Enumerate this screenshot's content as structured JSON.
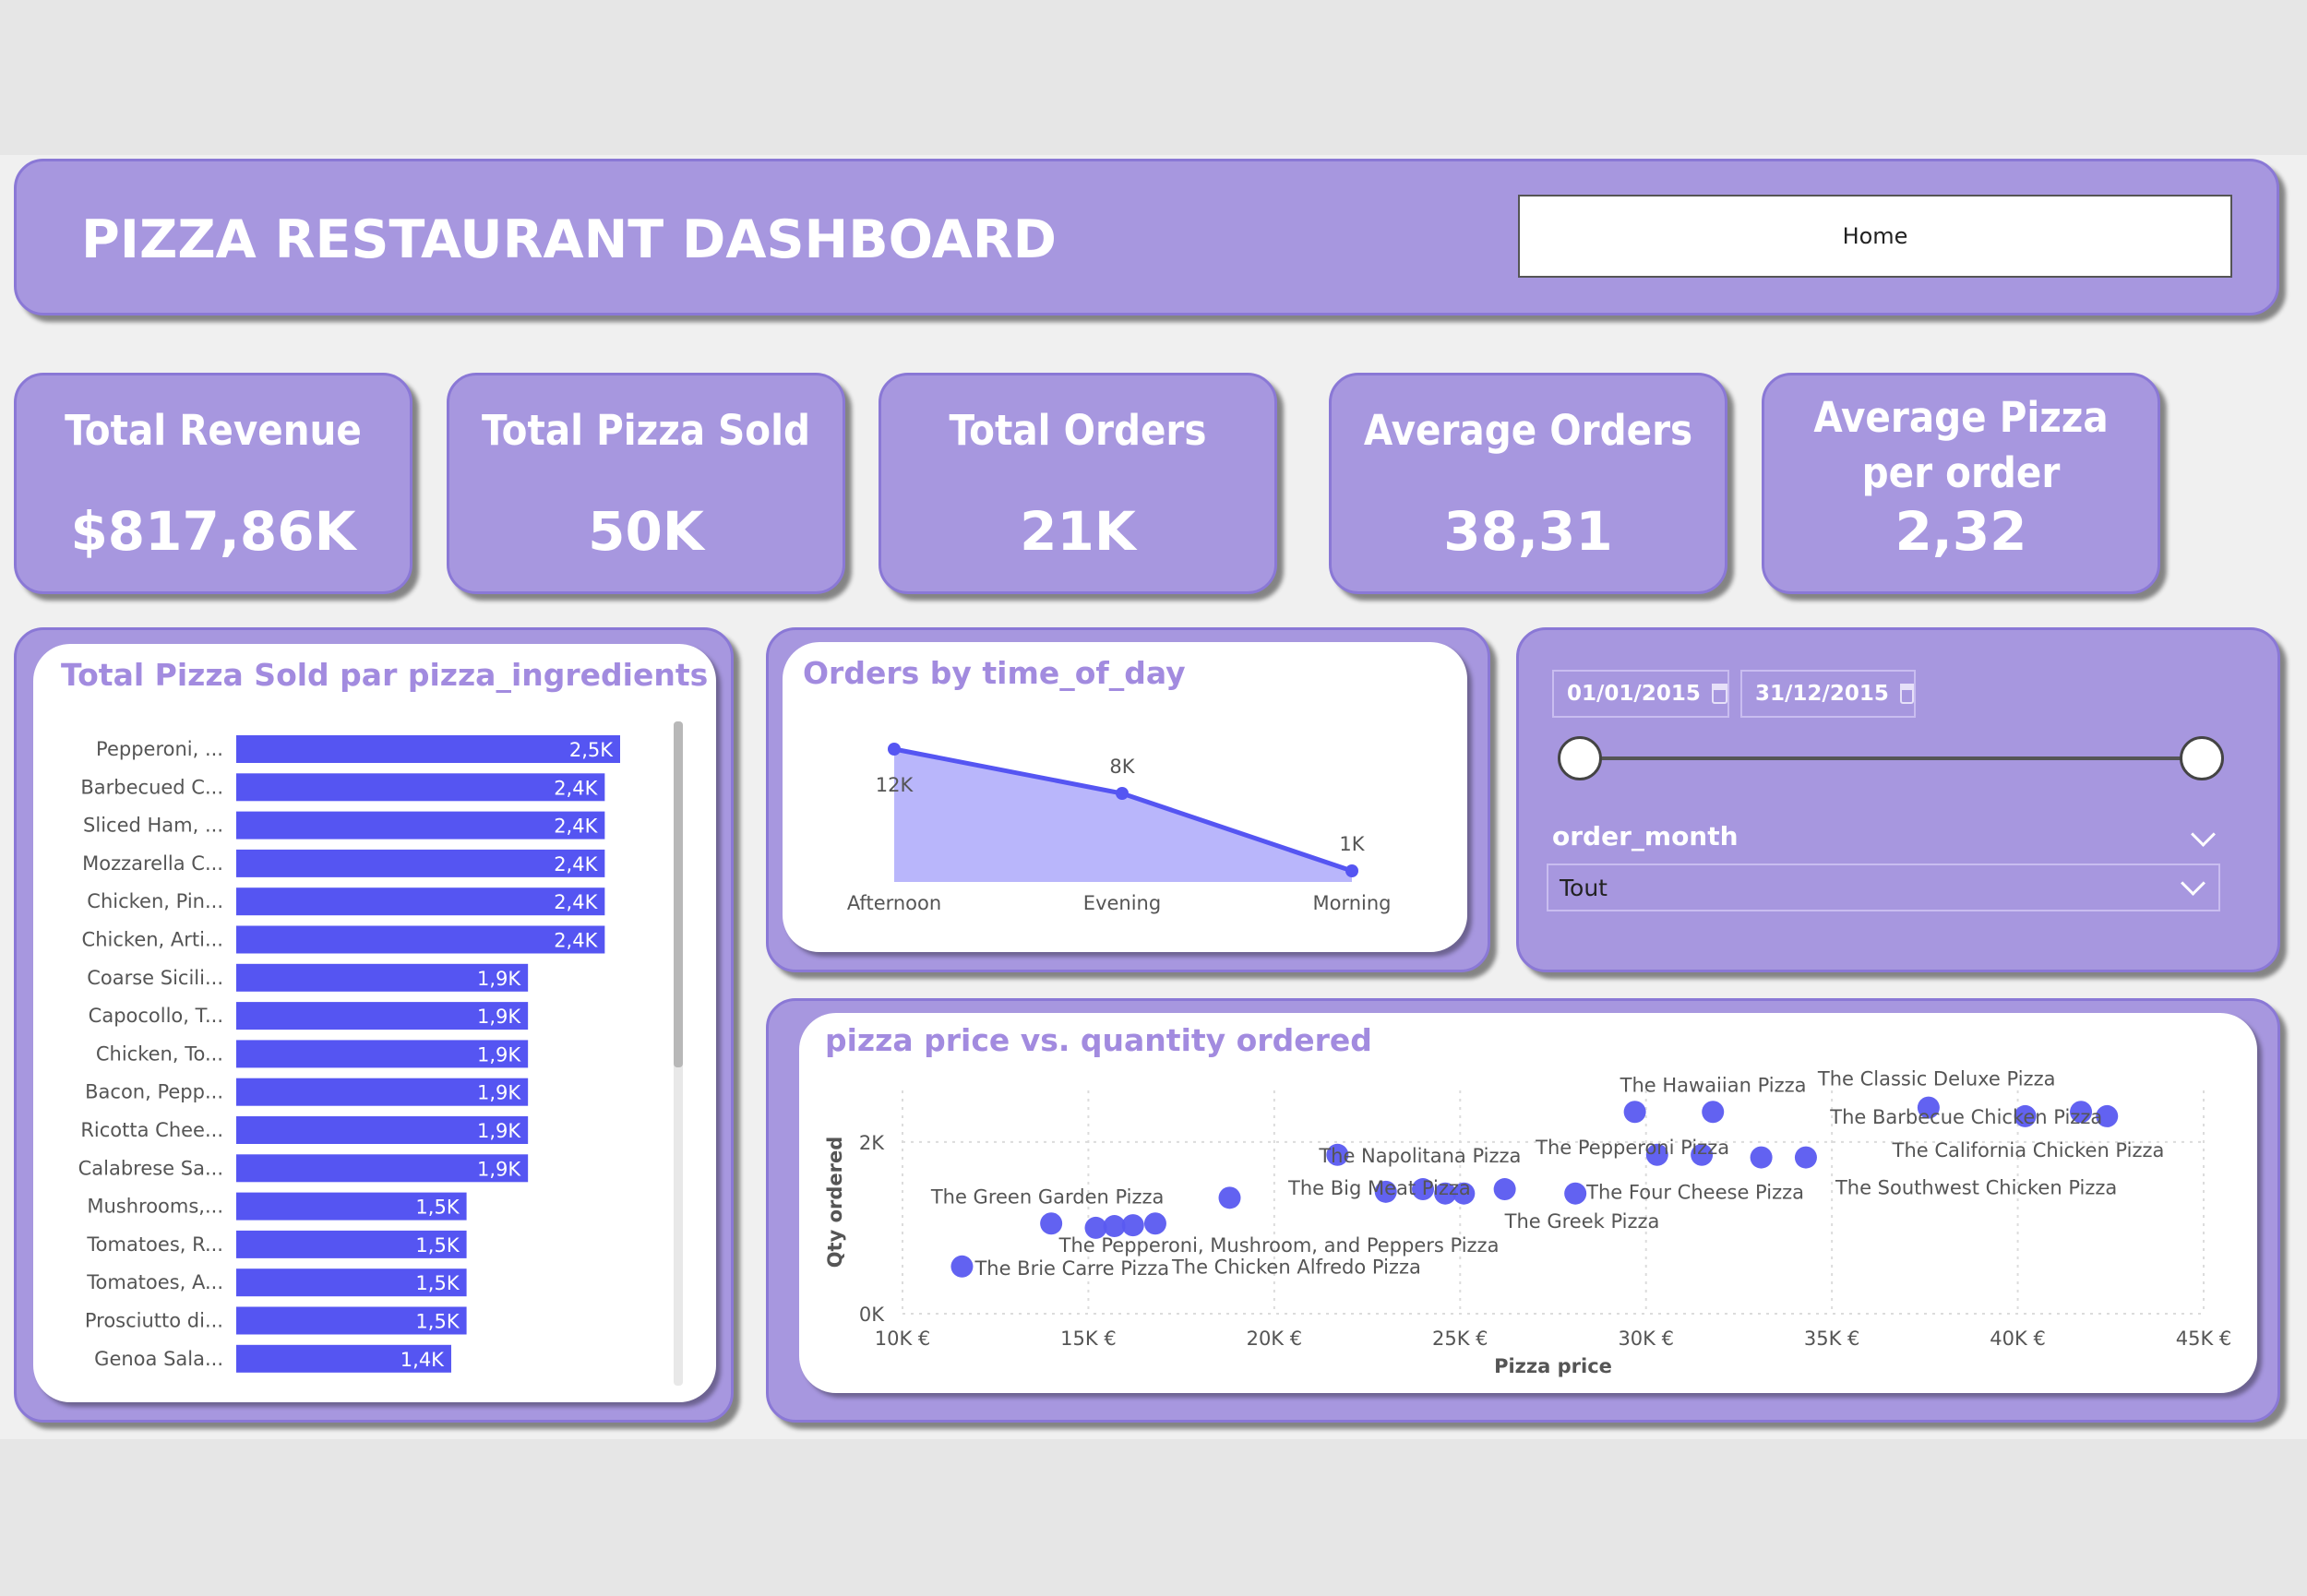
{
  "header": {
    "title": "PIZZA RESTAURANT DASHBOARD",
    "home_button": "Home"
  },
  "kpis": [
    {
      "label": "Total Revenue",
      "value": "$817,86K"
    },
    {
      "label": "Total Pizza Sold",
      "value": "50K"
    },
    {
      "label": "Total Orders",
      "value": "21K"
    },
    {
      "label": "Average Orders",
      "value": "38,31"
    },
    {
      "label": "Average Pizza per order",
      "value": "2,32"
    }
  ],
  "filters": {
    "date_start": "01/01/2015",
    "date_end": "31/12/2015",
    "month_label": "order_month",
    "month_value": "Tout"
  },
  "colors": {
    "panel": "#a797df",
    "bar": "#5555f2",
    "area": "#b9b6fb",
    "line": "#5555f2",
    "title": "#a28bdf"
  },
  "chart_data": [
    {
      "type": "bar",
      "orientation": "horizontal",
      "title": "Total Pizza Sold par pizza_ingredients",
      "categories": [
        "Pepperoni, ...",
        "Barbecued C...",
        "Sliced Ham, ...",
        "Mozzarella C...",
        "Chicken, Pin...",
        "Chicken, Arti...",
        "Coarse Sicili...",
        "Capocollo, T...",
        "Chicken, To...",
        "Bacon, Pepp...",
        "Ricotta Chee...",
        "Calabrese Sa...",
        "Mushrooms,...",
        "Tomatoes, R...",
        "Tomatoes, A...",
        "Prosciutto di...",
        "Genoa Sala..."
      ],
      "values": [
        2.5,
        2.4,
        2.4,
        2.4,
        2.4,
        2.4,
        1.9,
        1.9,
        1.9,
        1.9,
        1.9,
        1.9,
        1.5,
        1.5,
        1.5,
        1.5,
        1.4
      ],
      "value_labels": [
        "2,5K",
        "2,4K",
        "2,4K",
        "2,4K",
        "2,4K",
        "2,4K",
        "1,9K",
        "1,9K",
        "1,9K",
        "1,9K",
        "1,9K",
        "1,9K",
        "1,5K",
        "1,5K",
        "1,5K",
        "1,5K",
        "1,4K"
      ],
      "unit": "K",
      "xlim": [
        0,
        2.5
      ]
    },
    {
      "type": "area",
      "title": "Orders by time_of_day",
      "categories": [
        "Afternoon",
        "Evening",
        "Morning"
      ],
      "values": [
        12,
        8,
        1
      ],
      "value_labels": [
        "12K",
        "8K",
        "1K"
      ],
      "unit": "K",
      "ylim": [
        0,
        12
      ]
    },
    {
      "type": "scatter",
      "title": "pizza price vs. quantity ordered",
      "xlabel": "Pizza price",
      "ylabel": "Qty ordered",
      "xlim": [
        10,
        45
      ],
      "ylim": [
        0,
        2.6
      ],
      "x_ticks": [
        "10K €",
        "15K €",
        "20K €",
        "25K €",
        "30K €",
        "35K €",
        "40K €",
        "45K €"
      ],
      "y_ticks": [
        "0K",
        "2K"
      ],
      "points": [
        {
          "x": 11.6,
          "y": 0.55,
          "label": "The Brie Carre Pizza"
        },
        {
          "x": 14.0,
          "y": 1.05,
          "label": "The Green Garden Pizza"
        },
        {
          "x": 15.2,
          "y": 1.0,
          "label": ""
        },
        {
          "x": 15.7,
          "y": 1.02,
          "label": "The Pepperoni, Mushroom, and Peppers Pizza"
        },
        {
          "x": 16.2,
          "y": 1.03,
          "label": ""
        },
        {
          "x": 16.8,
          "y": 1.05,
          "label": "The Chicken Alfredo Pizza"
        },
        {
          "x": 18.8,
          "y": 1.35,
          "label": ""
        },
        {
          "x": 21.7,
          "y": 1.85,
          "label": "The Napolitana Pizza"
        },
        {
          "x": 23.0,
          "y": 1.42,
          "label": ""
        },
        {
          "x": 24.0,
          "y": 1.45,
          "label": "The Big Meat Pizza"
        },
        {
          "x": 24.6,
          "y": 1.4,
          "label": ""
        },
        {
          "x": 25.1,
          "y": 1.4,
          "label": ""
        },
        {
          "x": 26.2,
          "y": 1.45,
          "label": "The Greek Pizza"
        },
        {
          "x": 28.1,
          "y": 1.4,
          "label": "The Four Cheese Pizza"
        },
        {
          "x": 29.7,
          "y": 2.35,
          "label": "The Hawaiian Pizza"
        },
        {
          "x": 30.3,
          "y": 1.85,
          "label": ""
        },
        {
          "x": 31.5,
          "y": 1.85,
          "label": "The Pepperoni Pizza"
        },
        {
          "x": 31.8,
          "y": 2.35,
          "label": ""
        },
        {
          "x": 33.1,
          "y": 1.82,
          "label": ""
        },
        {
          "x": 34.3,
          "y": 1.82,
          "label": "The Southwest Chicken Pizza"
        },
        {
          "x": 37.6,
          "y": 2.4,
          "label": "The Classic Deluxe Pizza"
        },
        {
          "x": 40.2,
          "y": 2.3,
          "label": "The California Chicken Pizza"
        },
        {
          "x": 41.7,
          "y": 2.35,
          "label": ""
        },
        {
          "x": 42.4,
          "y": 2.3,
          "label": "The Barbecue Chicken Pizza"
        }
      ]
    }
  ]
}
